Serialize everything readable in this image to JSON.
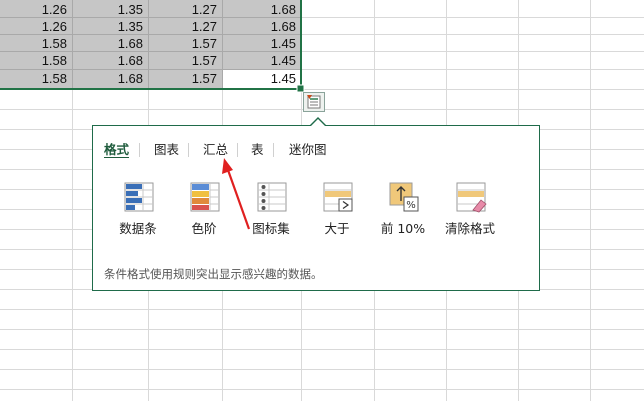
{
  "sheet": {
    "rows": [
      [
        "1.26",
        "1.35",
        "1.27",
        "1.68"
      ],
      [
        "1.26",
        "1.35",
        "1.27",
        "1.68"
      ],
      [
        "1.58",
        "1.68",
        "1.57",
        "1.45"
      ],
      [
        "1.58",
        "1.68",
        "1.57",
        "1.45"
      ],
      [
        "1.58",
        "1.68",
        "1.57",
        "1.45"
      ]
    ]
  },
  "quick_analysis": {
    "button_icon": "quick-analysis-icon",
    "tabs": [
      "格式",
      "图表",
      "汇总",
      "表",
      "迷你图"
    ],
    "active_tab": "格式",
    "tools": [
      {
        "label": "数据条",
        "icon": "data-bars-icon"
      },
      {
        "label": "色阶",
        "icon": "color-scale-icon"
      },
      {
        "label": "图标集",
        "icon": "icon-set-icon"
      },
      {
        "label": "大于",
        "icon": "greater-than-icon"
      },
      {
        "label": "前 10%",
        "icon": "top-10-percent-icon"
      },
      {
        "label": "清除格式",
        "icon": "clear-format-icon"
      }
    ],
    "description": "条件格式使用规则突出显示感兴趣的数据。"
  },
  "colors": {
    "selection_fill": "#c6c6c6",
    "accent": "#1f6b4a",
    "annotation_arrow": "#e02020"
  }
}
